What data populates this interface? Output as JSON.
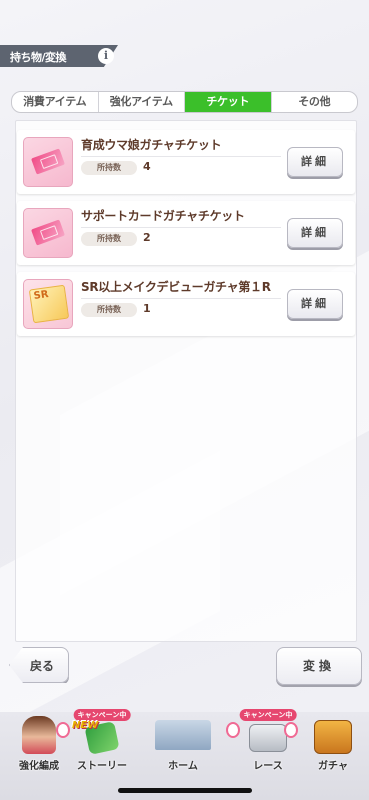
{
  "header": {
    "title": "持ち物/変換",
    "info_icon": "info-icon"
  },
  "tabs": [
    {
      "label": "消費アイテム",
      "active": false
    },
    {
      "label": "強化アイテム",
      "active": false
    },
    {
      "label": "チケット",
      "active": true
    },
    {
      "label": "その他",
      "active": false
    }
  ],
  "items": [
    {
      "name": "育成ウマ娘ガチャチケット",
      "own_label": "所持数",
      "count": "4",
      "detail_label": "詳細",
      "icon": "pink-ticket-icon"
    },
    {
      "name": "サポートカードガチャチケット",
      "own_label": "所持数",
      "count": "2",
      "detail_label": "詳細",
      "icon": "pink-ticket-icon"
    },
    {
      "name": "SR以上メイクデビューガチャ第１R",
      "own_label": "所持数",
      "count": "1",
      "detail_label": "詳細",
      "icon": "sr-ticket-icon",
      "icon_text": "SR"
    }
  ],
  "buttons": {
    "back": "戻る",
    "exchange": "変換"
  },
  "nav": {
    "new_tag": "NEW",
    "campaign_badge": "キャンペーン中",
    "items": [
      {
        "label": "強化編成"
      },
      {
        "label": "ストーリー"
      },
      {
        "label": "ホーム"
      },
      {
        "label": "レース"
      },
      {
        "label": "ガチャ"
      }
    ]
  },
  "colors": {
    "active_tab": "#3bbf2a",
    "header_bg": "#5d6470",
    "item_text": "#5e3a2a"
  }
}
